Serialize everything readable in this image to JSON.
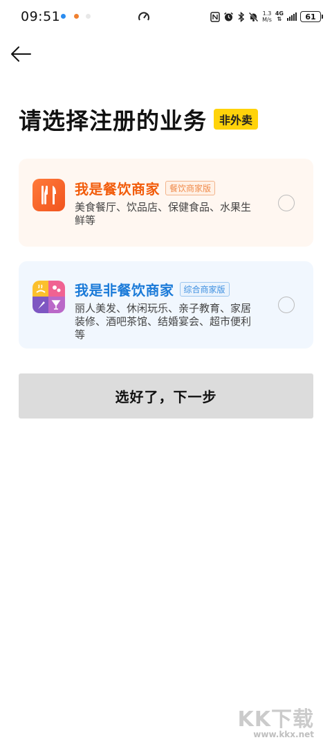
{
  "status_bar": {
    "time": "09:51",
    "net_speed_value": "1.3",
    "net_speed_unit": "M/s",
    "network_type": "4G",
    "battery": "61"
  },
  "page": {
    "title": "请选择注册的业务",
    "title_badge": "非外卖",
    "next_button_label": "选好了，下一步"
  },
  "options": [
    {
      "title": "我是餐饮商家",
      "tag": "餐饮商家版",
      "description": "美食餐厅、饮品店、保健食品、水果生鲜等",
      "icon": "cutlery-icon",
      "selected": false
    },
    {
      "title": "我是非餐饮商家",
      "tag": "综合商家版",
      "description": "丽人美发、休闲玩乐、亲子教育、家居装修、酒吧茶馆、结婚宴会、超市便利等",
      "icon": "multi-service-icon",
      "selected": false
    }
  ],
  "watermark": {
    "logo": "KK下载",
    "url": "www.kkx.net"
  },
  "colors": {
    "food_accent": "#f25c0b",
    "nonfood_accent": "#1a7ad8",
    "badge_yellow": "#ffd30a",
    "button_disabled_bg": "#dcdcdc"
  }
}
